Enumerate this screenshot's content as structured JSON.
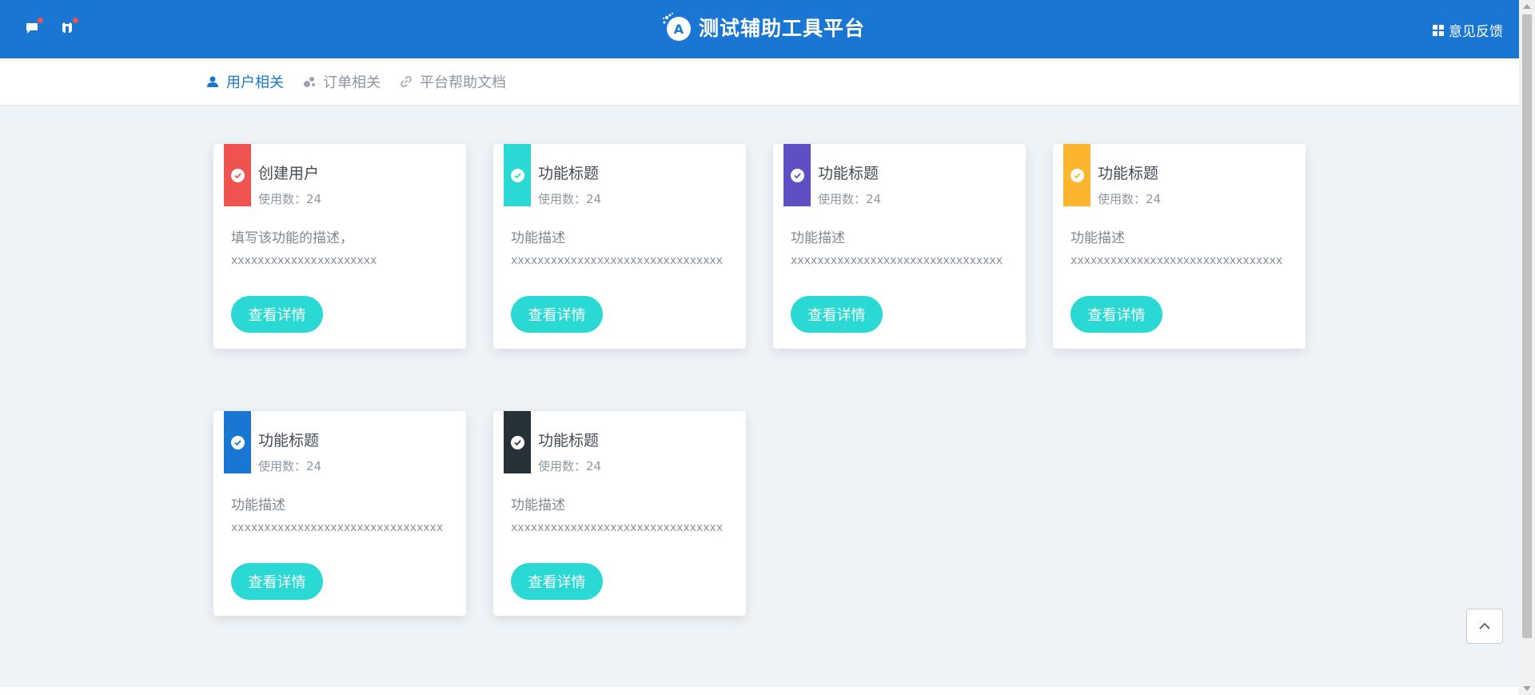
{
  "header": {
    "brand_title": "测试辅助工具平台",
    "feedback_label": "意见反馈",
    "brand_color": "#1976d2"
  },
  "subnav": {
    "tabs": [
      {
        "label": "用户相关",
        "icon": "user-icon",
        "active": true
      },
      {
        "label": "订单相关",
        "icon": "order-icon",
        "active": false
      },
      {
        "label": "平台帮助文档",
        "icon": "link-icon",
        "active": false
      }
    ]
  },
  "cards": [
    {
      "title": "创建用户",
      "usage": "使用数：24",
      "desc_line1": "填写该功能的描述，",
      "desc_line2": "xxxxxxxxxxxxxxxxxxxxxx",
      "button": "查看详情",
      "color": "#ef5350"
    },
    {
      "title": "功能标题",
      "usage": "使用数：24",
      "desc_line1": "功能描述",
      "desc_line2": "xxxxxxxxxxxxxxxxxxxxxxxxxxxxxxxx",
      "button": "查看详情",
      "color": "#2ad9d3"
    },
    {
      "title": "功能标题",
      "usage": "使用数：24",
      "desc_line1": "功能描述",
      "desc_line2": "xxxxxxxxxxxxxxxxxxxxxxxxxxxxxxxx",
      "button": "查看详情",
      "color": "#5e4fc4"
    },
    {
      "title": "功能标题",
      "usage": "使用数：24",
      "desc_line1": "功能描述",
      "desc_line2": "xxxxxxxxxxxxxxxxxxxxxxxxxxxxxxxx",
      "button": "查看详情",
      "color": "#fbb52e"
    },
    {
      "title": "功能标题",
      "usage": "使用数：24",
      "desc_line1": "功能描述",
      "desc_line2": "xxxxxxxxxxxxxxxxxxxxxxxxxxxxxxxx",
      "button": "查看详情",
      "color": "#1976d2"
    },
    {
      "title": "功能标题",
      "usage": "使用数：24",
      "desc_line1": "功能描述",
      "desc_line2": "xxxxxxxxxxxxxxxxxxxxxxxxxxxxxxxx",
      "button": "查看详情",
      "color": "#263238"
    }
  ],
  "back_to_top": {
    "icon": "chevron-up-icon"
  }
}
